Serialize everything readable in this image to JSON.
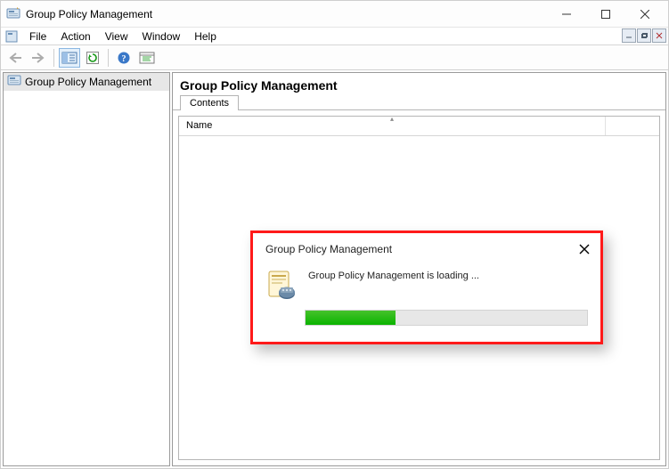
{
  "window": {
    "title": "Group Policy Management"
  },
  "menu": {
    "file": "File",
    "action": "Action",
    "view": "View",
    "window": "Window",
    "help": "Help"
  },
  "tree": {
    "root": "Group Policy Management"
  },
  "content": {
    "header": "Group Policy Management",
    "tab_contents": "Contents",
    "column_name": "Name"
  },
  "modal": {
    "title": "Group Policy Management",
    "message": "Group Policy Management is loading ...",
    "progress_percent": 32
  },
  "colors": {
    "highlight_border": "#ff1a1a",
    "progress_green": "#0bb400"
  }
}
